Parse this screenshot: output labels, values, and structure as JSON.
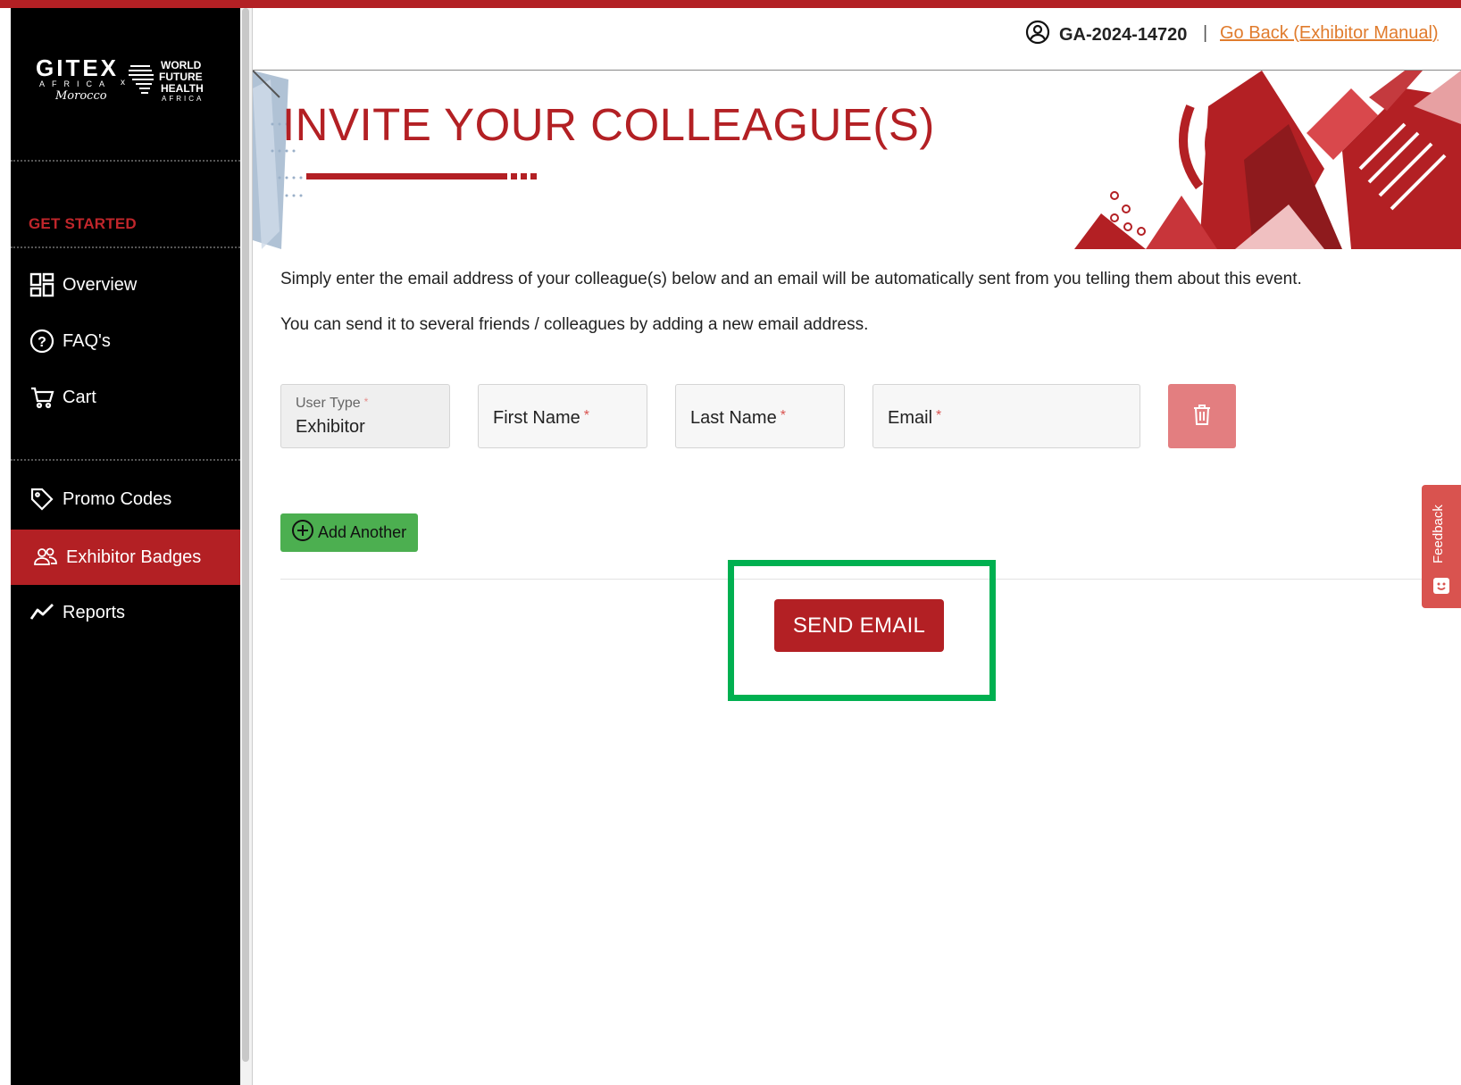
{
  "sidebar": {
    "logo": {
      "brand": "GITEX",
      "brand_sub": "AFRICA",
      "brand_script": "Morocco",
      "partner_lines": [
        "WORLD",
        "FUTURE",
        "HEALTH",
        "AFRICA"
      ]
    },
    "section_label": "GET STARTED",
    "items": [
      {
        "label": "Overview",
        "icon": "overview-grid-icon"
      },
      {
        "label": "FAQ's",
        "icon": "question-circle-icon"
      },
      {
        "label": "Cart",
        "icon": "cart-icon"
      },
      {
        "label": "Promo Codes",
        "icon": "tag-icon"
      },
      {
        "label": "Exhibitor Badges",
        "icon": "users-icon",
        "active": true
      },
      {
        "label": "Reports",
        "icon": "trend-line-icon"
      }
    ]
  },
  "header": {
    "user_id": "GA-2024-14720",
    "separator": "|",
    "go_back_link": "Go Back (Exhibitor Manual)"
  },
  "page": {
    "title": "INVITE YOUR COLLEAGUE(S)",
    "description_1": "Simply enter the email address of your colleague(s) below and an email will be automatically sent from you telling them about this event.",
    "description_2": "You can send it to several friends / colleagues by adding a new email address."
  },
  "form": {
    "user_type_label": "User Type",
    "user_type_value": "Exhibitor",
    "first_name_placeholder": "First Name",
    "last_name_placeholder": "Last Name",
    "email_placeholder": "Email",
    "required_mark": "*",
    "add_another_label": "Add Another",
    "send_email_label": "SEND EMAIL"
  },
  "feedback_tab": {
    "label": "Feedback"
  },
  "colors": {
    "brand_red": "#b32024",
    "highlight_green": "#00b050",
    "add_button_green": "#4caf50",
    "delete_button": "#e37e80",
    "link_orange": "#e07b2c"
  }
}
